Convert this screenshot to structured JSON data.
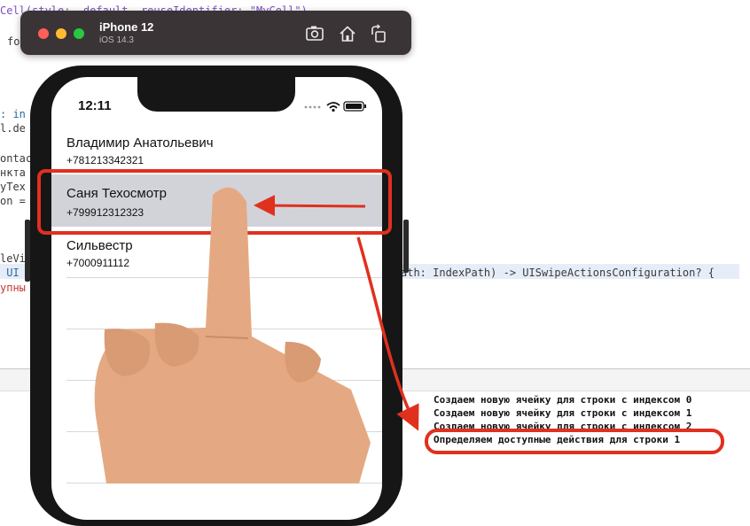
{
  "editor": {
    "lines": [
      "Cell(style: .default, reuseIdentifier: \"MyCell\")",
      "fo",
      ": in",
      "l.de",
      "ontac",
      "нкта",
      "yTex",
      "on =",
      "leVi",
      " UI",
      "упны",
      "ath: IndexPath) -> UISwipeActionsConfiguration? {"
    ]
  },
  "simulator": {
    "device": "iPhone 12",
    "os": "iOS 14.3",
    "toolbar": [
      "screenshot-icon",
      "home-icon",
      "rotate-icon"
    ],
    "traffic_colors": {
      "close": "#ff5f57",
      "minimize": "#febc2e",
      "zoom": "#28c840"
    }
  },
  "phone": {
    "time": "12:11",
    "contacts": [
      {
        "name": "Владимир Анатольевич",
        "phone": "+781213342321"
      },
      {
        "name": "Саня Техосмотр",
        "phone": "+799912312323"
      },
      {
        "name": "Сильвестр",
        "phone": "+7000911112"
      }
    ]
  },
  "console": {
    "lines": [
      "Создаем новую ячейку для строки с индексом 0",
      "Создаем новую ячейку для строки с индексом 1",
      "Создаем новую ячейку для строки с индексом 2",
      "Определяем доступные действия для строки 1"
    ]
  },
  "annotation": {
    "accent": "#e0301e",
    "skin": "#e4a982",
    "selection": "#d2d3d9"
  }
}
